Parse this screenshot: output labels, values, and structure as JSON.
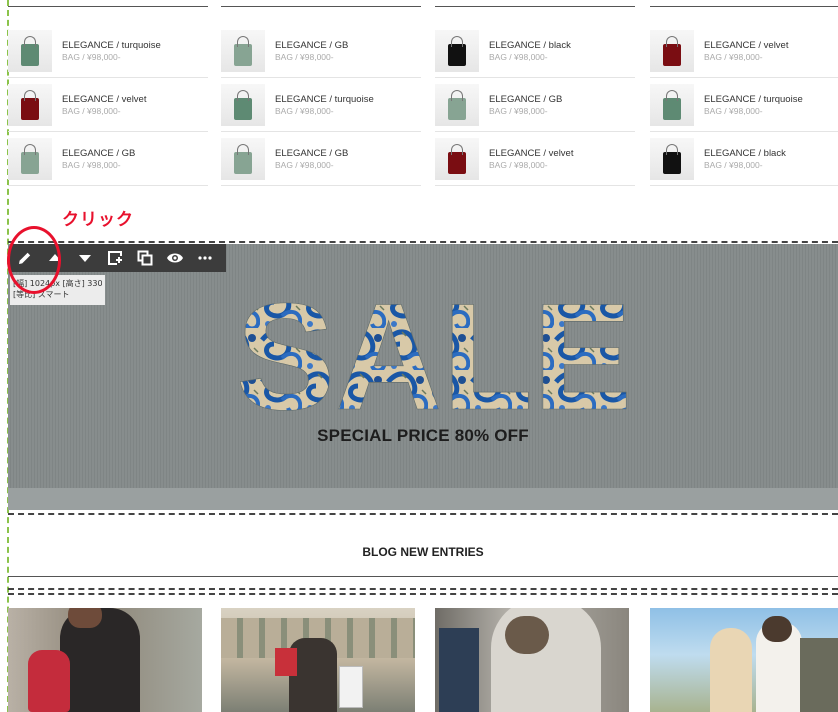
{
  "products": [
    [
      {
        "name": "ELEGANCE / turquoise",
        "price": "BAG / ¥98,000-",
        "color": "turquoise"
      },
      {
        "name": "ELEGANCE / velvet",
        "price": "BAG / ¥98,000-",
        "color": "velvet"
      },
      {
        "name": "ELEGANCE / GB",
        "price": "BAG / ¥98,000-",
        "color": "gb"
      }
    ],
    [
      {
        "name": "ELEGANCE / GB",
        "price": "BAG / ¥98,000-",
        "color": "gb"
      },
      {
        "name": "ELEGANCE / turquoise",
        "price": "BAG / ¥98,000-",
        "color": "turquoise"
      },
      {
        "name": "ELEGANCE / GB",
        "price": "BAG / ¥98,000-",
        "color": "gb"
      }
    ],
    [
      {
        "name": "ELEGANCE / black",
        "price": "BAG / ¥98,000-",
        "color": "black"
      },
      {
        "name": "ELEGANCE / GB",
        "price": "BAG / ¥98,000-",
        "color": "gb"
      },
      {
        "name": "ELEGANCE / velvet",
        "price": "BAG / ¥98,000-",
        "color": "velvet"
      }
    ],
    [
      {
        "name": "ELEGANCE / velvet",
        "price": "BAG / ¥98,000-",
        "color": "velvet"
      },
      {
        "name": "ELEGANCE / turquoise",
        "price": "BAG / ¥98,000-",
        "color": "turquoise"
      },
      {
        "name": "ELEGANCE / black",
        "price": "BAG / ¥98,000-",
        "color": "black"
      }
    ]
  ],
  "annotation": {
    "label": "クリック",
    "color": "#e8112d"
  },
  "toolbar": {
    "buttons": [
      {
        "icon": "pencil-icon",
        "action": "edit"
      },
      {
        "icon": "triangle-up-icon",
        "action": "move-up"
      },
      {
        "icon": "triangle-down-icon",
        "action": "move-down"
      },
      {
        "icon": "add-block-icon",
        "action": "add"
      },
      {
        "icon": "duplicate-icon",
        "action": "copy"
      },
      {
        "icon": "eye-icon",
        "action": "preview"
      },
      {
        "icon": "more-icon",
        "action": "more"
      }
    ]
  },
  "size_info": {
    "line1": "[幅] 1024px [高さ] 330",
    "line2": "[等比] スマート"
  },
  "sale": {
    "title": "SALE",
    "subtitle": "SPECIAL PRICE 80% OFF"
  },
  "blog": {
    "heading": "BLOG NEW ENTRIES"
  },
  "colors": {
    "bag_turquoise": "#5e8a73",
    "bag_gb": "#87a493",
    "bag_black": "#111111",
    "bag_velvet": "#7a0d12",
    "guide_green": "#8bc34a",
    "toolbar_bg": "#3c3c3c"
  }
}
